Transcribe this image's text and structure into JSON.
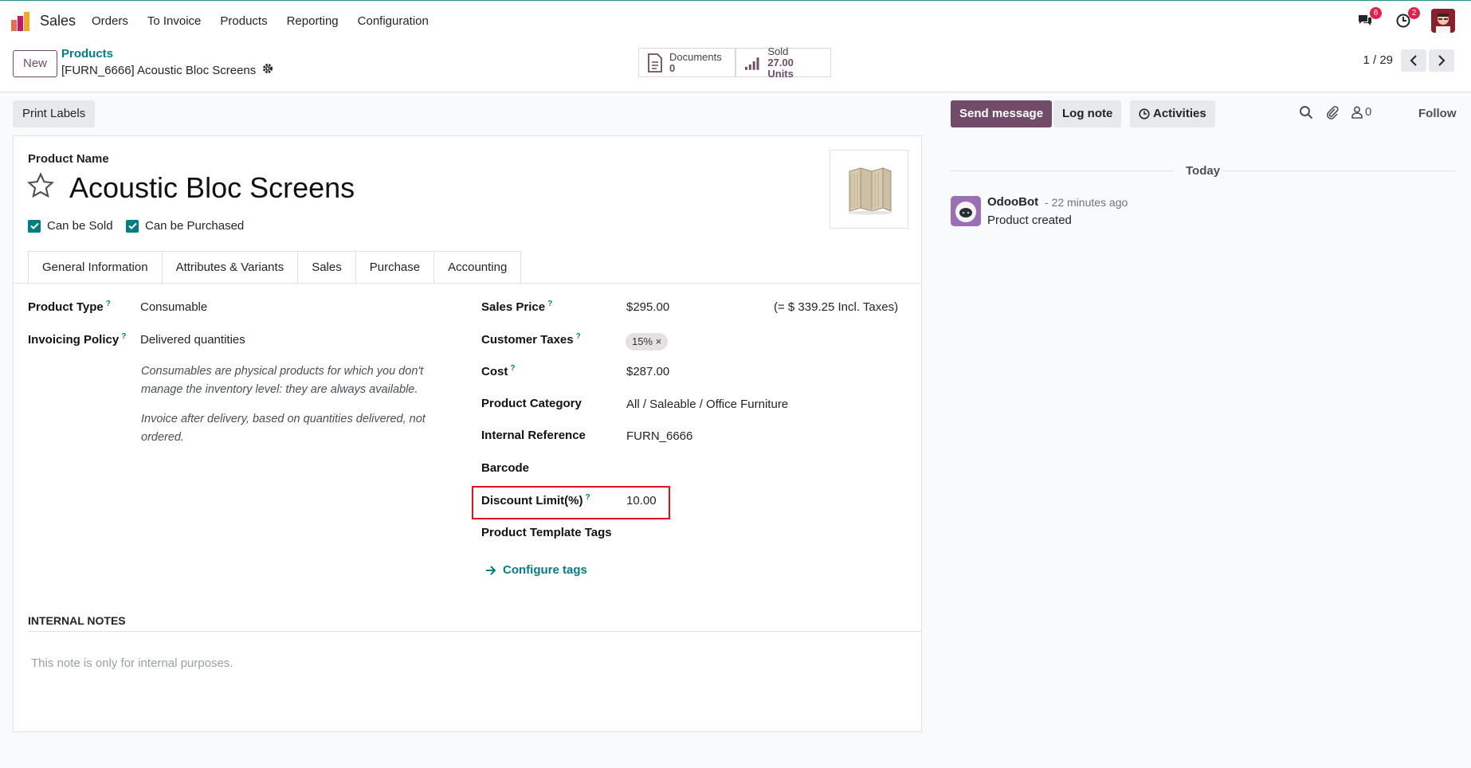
{
  "app": {
    "name": "Sales"
  },
  "menu": [
    "Orders",
    "To Invoice",
    "Products",
    "Reporting",
    "Configuration"
  ],
  "notifications": {
    "messages_count": "6",
    "activities_count": "2"
  },
  "control_panel": {
    "new_label": "New",
    "breadcrumb_parent": "Products",
    "breadcrumb_current": "[FURN_6666] Acoustic Bloc Screens",
    "documents_label": "Documents",
    "documents_count": "0",
    "sold_label": "Sold",
    "sold_value": "27.00 Units",
    "pager": "1 / 29"
  },
  "status_bar": {
    "print_labels": "Print Labels"
  },
  "form": {
    "product_name_label": "Product Name",
    "product_name": "Acoustic Bloc Screens",
    "can_be_sold": "Can be Sold",
    "can_be_purchased": "Can be Purchased",
    "tabs": [
      "General Information",
      "Attributes & Variants",
      "Sales",
      "Purchase",
      "Accounting"
    ],
    "left": {
      "product_type_label": "Product Type",
      "product_type": "Consumable",
      "invoicing_policy_label": "Invoicing Policy",
      "invoicing_policy": "Delivered quantities",
      "help_consumable": "Consumables are physical products for which you don't manage the inventory level: they are always available.",
      "help_invoice": "Invoice after delivery, based on quantities delivered, not ordered."
    },
    "right": {
      "sales_price_label": "Sales Price",
      "sales_price": "$295.00",
      "incl_taxes": "(= $ 339.25 Incl. Taxes)",
      "customer_taxes_label": "Customer Taxes",
      "customer_taxes_tag": "15%",
      "cost_label": "Cost",
      "cost": "$287.00",
      "product_category_label": "Product Category",
      "product_category": "All / Saleable / Office Furniture",
      "internal_reference_label": "Internal Reference",
      "internal_reference": "FURN_6666",
      "barcode_label": "Barcode",
      "discount_limit_label": "Discount Limit(%)",
      "discount_limit": "10.00",
      "template_tags_label": "Product Template Tags",
      "configure_tags": "Configure tags"
    },
    "notes_heading": "INTERNAL NOTES",
    "notes_placeholder": "This note is only for internal purposes."
  },
  "chatter": {
    "send_message": "Send message",
    "log_note": "Log note",
    "activities": "Activities",
    "followers_count": "0",
    "follow": "Follow",
    "date_separator": "Today",
    "author": "OdooBot",
    "time": "- 22 minutes ago",
    "message": "Product created"
  },
  "colors": {
    "brand": "#714b67",
    "link": "#017e84",
    "highlight": "#e0141e"
  }
}
